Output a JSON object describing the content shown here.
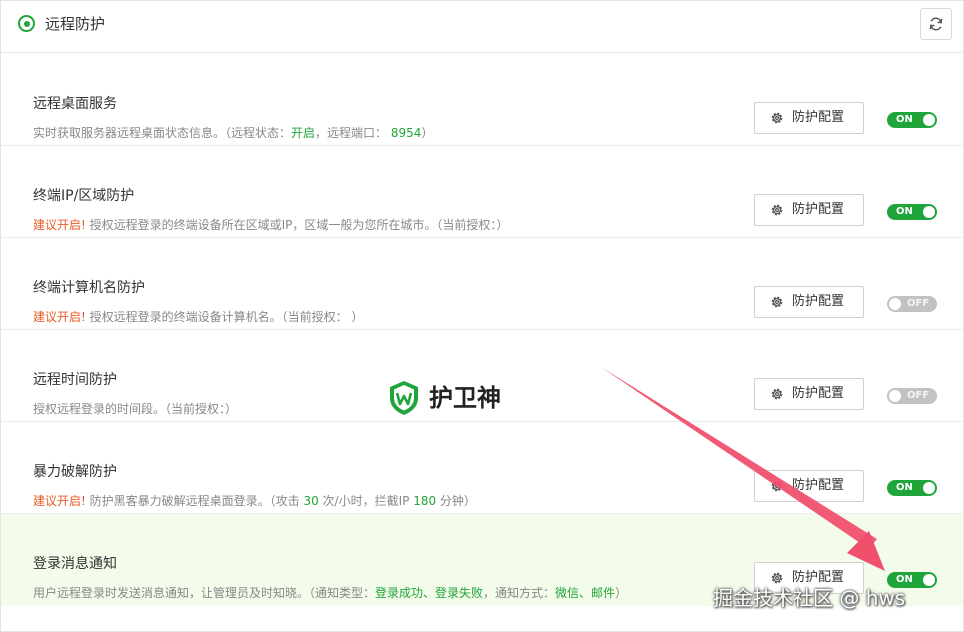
{
  "header": {
    "title": "远程防护",
    "refresh_icon": "refresh-icon",
    "accent": "#20a53a"
  },
  "config_label": "防护配置",
  "rows": [
    {
      "title": "远程桌面服务",
      "desc": [
        {
          "t": "实时获取服务器远程桌面状态信息。（远程状态："
        },
        {
          "t": "开启",
          "c": "green"
        },
        {
          "t": "，远程端口：  "
        },
        {
          "t": "8954",
          "c": "green"
        },
        {
          "t": "）"
        }
      ],
      "toggle": "on",
      "toggle_label": "ON"
    },
    {
      "title": "终端IP/区域防护",
      "desc": [
        {
          "t": "建议开启!",
          "c": "warn"
        },
        {
          "t": " 授权远程登录的终端设备所在区域或IP，区域一般为您所在城市。（当前授权：）"
        }
      ],
      "toggle": "on",
      "toggle_label": "ON"
    },
    {
      "title": "终端计算机名防护",
      "desc": [
        {
          "t": "建议开启!",
          "c": "warn"
        },
        {
          "t": " 授权远程登录的终端设备计算机名。（当前授权：  ）"
        }
      ],
      "toggle": "off",
      "toggle_label": "OFF"
    },
    {
      "title": "远程时间防护",
      "desc": [
        {
          "t": "授权远程登录的时间段。（当前授权：）"
        }
      ],
      "toggle": "off",
      "toggle_label": "OFF"
    },
    {
      "title": "暴力破解防护",
      "desc": [
        {
          "t": "建议开启!",
          "c": "warn"
        },
        {
          "t": "  防护黑客暴力破解远程桌面登录。（攻击 "
        },
        {
          "t": "30",
          "c": "green"
        },
        {
          "t": " 次/小时，拦截IP "
        },
        {
          "t": "180",
          "c": "green"
        },
        {
          "t": " 分钟）"
        }
      ],
      "toggle": "on",
      "toggle_label": "ON"
    },
    {
      "title": "登录消息通知",
      "desc": [
        {
          "t": "用户远程登录时发送消息通知，让管理员及时知晓。（通知类型："
        },
        {
          "t": "登录成功、登录失败",
          "c": "green"
        },
        {
          "t": "，通知方式："
        },
        {
          "t": "微信、邮件",
          "c": "green"
        },
        {
          "t": "）"
        }
      ],
      "toggle": "on",
      "toggle_label": "ON",
      "highlight": true
    }
  ],
  "watermark": {
    "text": "护卫神",
    "logo_icon": "shield-w-icon"
  },
  "corner_watermark": "掘金技术社区 @ hws",
  "annotation_arrow": {
    "color": "#f0506e"
  }
}
